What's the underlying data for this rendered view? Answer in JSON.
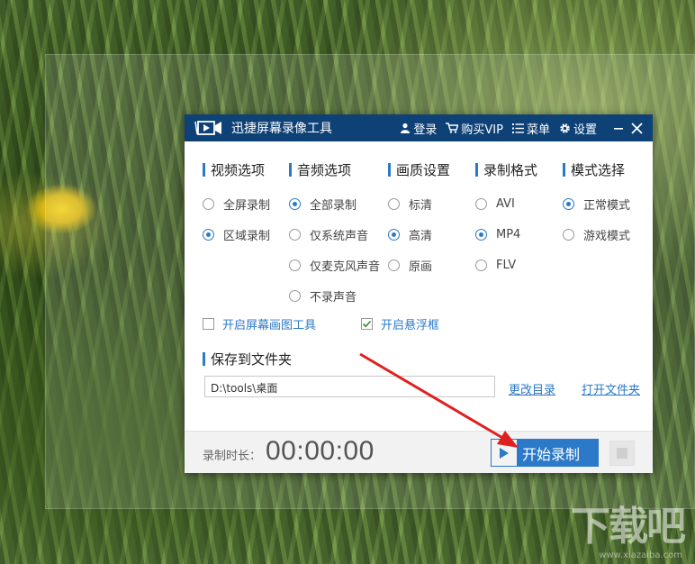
{
  "window": {
    "title": "迅捷屏幕录像工具"
  },
  "titlebar": {
    "login_label": "登录",
    "vip_label": "购买VIP",
    "menu_label": "菜单",
    "settings_label": "设置"
  },
  "sections": {
    "video": {
      "title": "视频选项",
      "options": [
        {
          "label": "全屏录制",
          "selected": false
        },
        {
          "label": "区域录制",
          "selected": true
        }
      ]
    },
    "audio": {
      "title": "音频选项",
      "options": [
        {
          "label": "全部录制",
          "selected": true
        },
        {
          "label": "仅系统声音",
          "selected": false
        },
        {
          "label": "仅麦克风声音",
          "selected": false
        },
        {
          "label": "不录声音",
          "selected": false
        }
      ]
    },
    "quality": {
      "title": "画质设置",
      "options": [
        {
          "label": "标清",
          "selected": false
        },
        {
          "label": "高清",
          "selected": true
        },
        {
          "label": "原画",
          "selected": false
        }
      ]
    },
    "format": {
      "title": "录制格式",
      "options": [
        {
          "label": "AVI",
          "selected": false
        },
        {
          "label": "MP4",
          "selected": true
        },
        {
          "label": "FLV",
          "selected": false
        }
      ]
    },
    "mode": {
      "title": "模式选择",
      "options": [
        {
          "label": "正常模式",
          "selected": true
        },
        {
          "label": "游戏模式",
          "selected": false
        }
      ]
    }
  },
  "checkboxes": {
    "draw_tool": {
      "label": "开启屏幕画图工具",
      "checked": false
    },
    "float_box": {
      "label": "开启悬浮框",
      "checked": true
    }
  },
  "save": {
    "title": "保存到文件夹",
    "path": "D:\\tools\\桌面",
    "change_dir_label": "更改目录",
    "open_folder_label": "打开文件夹"
  },
  "footer": {
    "time_label": "录制时长：",
    "time_value": "00:00:00",
    "start_label": "开始录制"
  },
  "colors": {
    "titlebar": "#0e4176",
    "accent": "#2b79c8",
    "arrow": "#e02020"
  },
  "watermark": {
    "text": "下载吧",
    "sub": "www.xiazaiba.com"
  }
}
